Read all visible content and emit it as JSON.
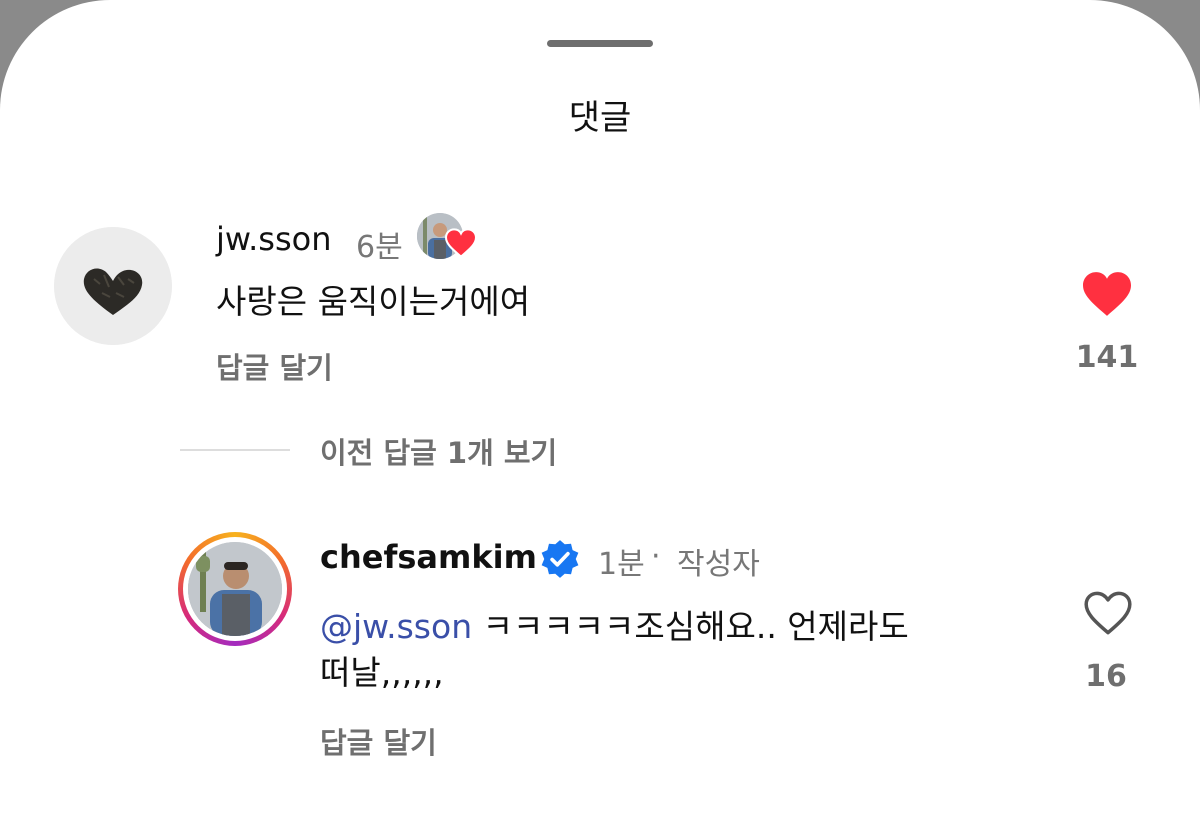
{
  "sheet": {
    "title": "댓글"
  },
  "comments": [
    {
      "username": "jw.sson",
      "time": "6분",
      "text": "사랑은 움직이는거에여",
      "reply_label": "답글 달기",
      "likes": "141",
      "liked": true,
      "liked_by_author": true
    }
  ],
  "thread": {
    "view_previous_label": "이전 답글 1개 보기"
  },
  "replies": [
    {
      "username": "chefsamkim",
      "verified": true,
      "time": "1분",
      "separator": "·",
      "author_tag": "작성자",
      "mention": "@jw.sson",
      "text_line1": " ㅋㅋㅋㅋㅋ조심해요.. 언제라도",
      "text_line2": "떠날,,,,,,",
      "reply_label": "답글 달기",
      "likes": "16",
      "liked": false
    }
  ],
  "colors": {
    "like_red": "#ff3040",
    "mention_blue": "#3a4fa8",
    "verified_blue": "#1877f2"
  }
}
